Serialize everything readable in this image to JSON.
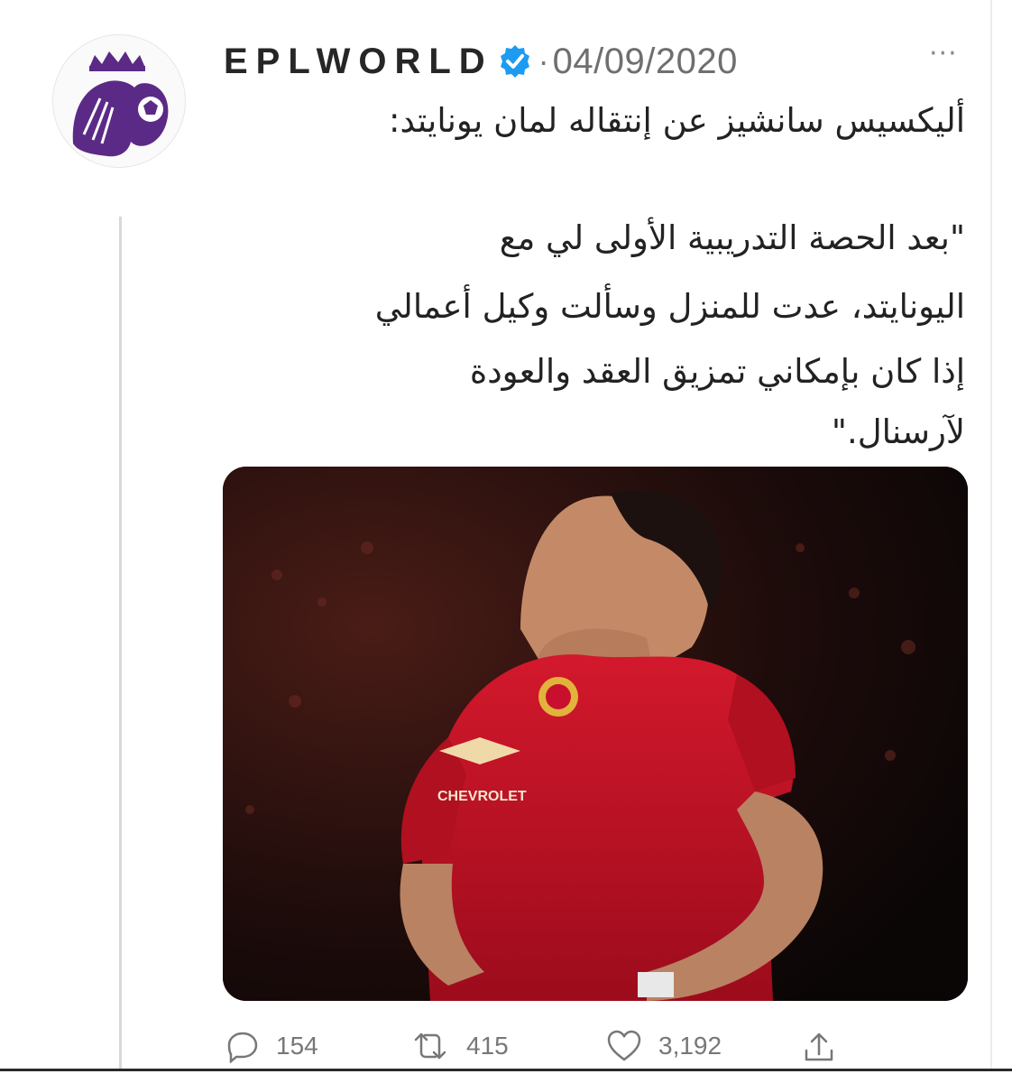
{
  "tweet": {
    "username": "EPLWORLD",
    "separator": "·",
    "date": "04/09/2020",
    "more_label": "···",
    "text_lines": [
      "أليكسيس سانشيز عن إنتقاله لمان يونايتد:",
      "\"بعد الحصة التدريبية الأولى لي مع",
      "اليونايتد، عدت للمنزل وسألت وكيل أعمالي",
      "إذا كان بإمكاني تمزيق العقد والعودة",
      "لآرسنال.\""
    ],
    "media": {
      "jersey_sponsor": "CHEVROLET"
    },
    "actions": {
      "replies": "154",
      "retweets": "415",
      "likes": "3,192"
    }
  },
  "colors": {
    "verified_blue": "#1d9bf0",
    "avatar_purple": "#5b2a86",
    "jersey_red": "#c8102e",
    "text_gray": "#777777"
  },
  "icons": {
    "avatar": "premier-league-lion-logo",
    "verified": "verified-badge-icon",
    "more": "more-options-icon",
    "reply": "reply-icon",
    "retweet": "retweet-icon",
    "like": "heart-icon",
    "share": "share-icon"
  }
}
